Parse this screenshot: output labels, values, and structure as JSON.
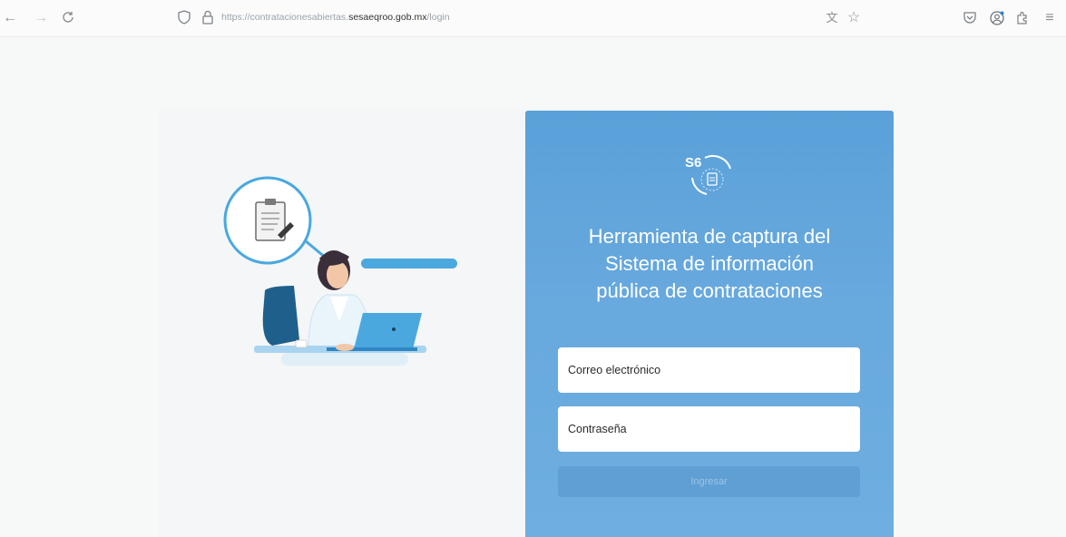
{
  "browser": {
    "url_scheme": "https://",
    "url_subdomain": "contratacionesabiertas.",
    "url_host": "sesaeqroo.gob.mx",
    "url_path": "/login",
    "icons": [
      "back-icon",
      "forward-icon",
      "reload-icon",
      "shield-icon",
      "lock-icon",
      "translate-icon",
      "star-icon",
      "pocket-icon",
      "account-icon",
      "extensions-icon",
      "menu-icon"
    ]
  },
  "logo": {
    "text": "S6"
  },
  "login": {
    "title_line1": "Herramienta de captura del",
    "title_line2": "Sistema de información",
    "title_line3": "pública de contrataciones",
    "email_placeholder": "Correo electrónico",
    "password_placeholder": "Contraseña",
    "submit_label": "Ingresar"
  },
  "colors": {
    "panel": "#64a6dc",
    "submit": "#5f9fd3",
    "accent": "#4aa8df"
  }
}
